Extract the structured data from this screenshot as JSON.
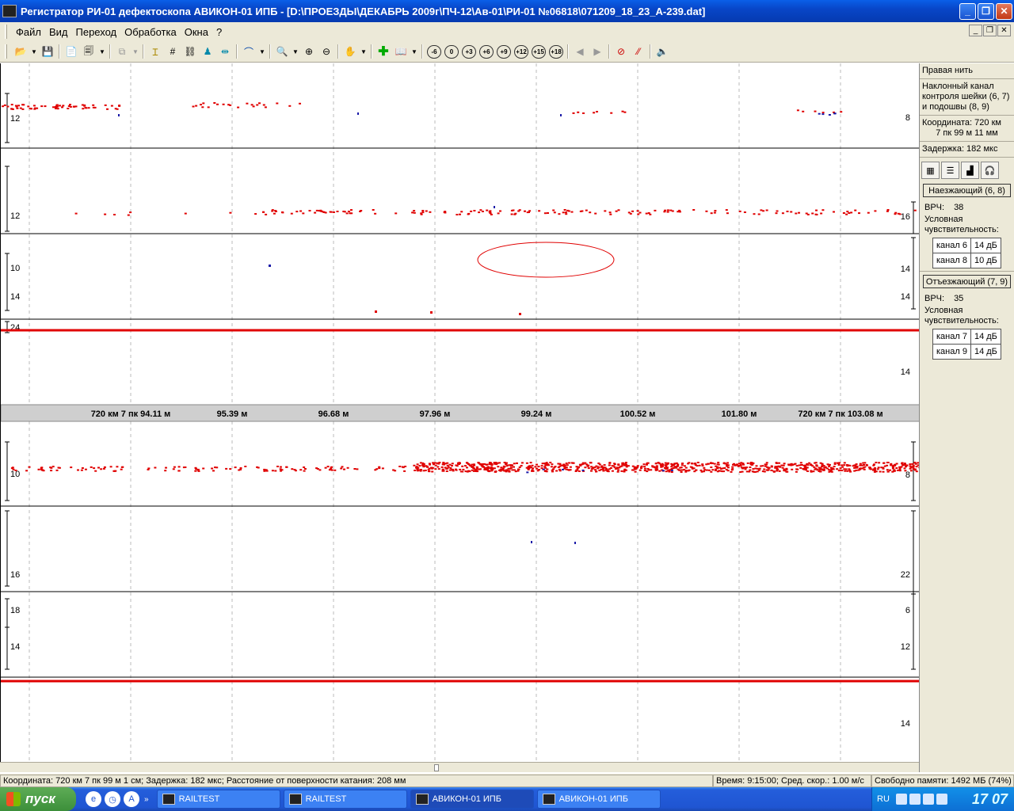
{
  "window": {
    "title": "Регистратор РИ-01 дефектоскопа АВИКОН-01 ИПБ - [D:\\ПРОЕЗДЫ\\ДЕКАБРЬ 2009г\\ПЧ-12\\Ав-01\\РИ-01 №06818\\071209_18_23_A-239.dat]",
    "min": "_",
    "max": "❐",
    "close": "✕"
  },
  "menu": [
    "Файл",
    "Вид",
    "Переход",
    "Обработка",
    "Окна",
    "?"
  ],
  "mdi": [
    "_",
    "❐",
    "✕"
  ],
  "toolbar": {
    "range_buttons": [
      "-6",
      "0",
      "+3",
      "+6",
      "+9",
      "+12",
      "+15",
      "+18"
    ]
  },
  "plot": {
    "divider_labels": [
      "720 км 7 пк 94.11 м",
      "95.39 м",
      "96.68 м",
      "97.96 м",
      "99.24 м",
      "100.52 м",
      "101.80 м",
      "720 км 7 пк 103.08 м"
    ],
    "left_labels": [
      "12",
      "12",
      "10",
      "14",
      "24",
      "10",
      "16",
      "18",
      "14"
    ],
    "right_labels": [
      "8",
      "16",
      "14",
      "14",
      "14",
      "8",
      "22",
      "6",
      "12",
      "14"
    ]
  },
  "right_panel": {
    "thread": "Правая нить",
    "channel_desc": "Наклонный канал контроля шейки (6, 7) и подошвы (8, 9)",
    "coord_line1": "Координата: 720 км",
    "coord_line2": "7 пк 99 м 11 мм",
    "delay": "Задержка: 182 мкс",
    "incoming": {
      "title": "Наезжающий (6, 8)",
      "vrch_label": "ВРЧ:",
      "vrch_value": "38",
      "sens_label": "Условная чувствительность:",
      "rows": [
        [
          "канал 6",
          "14 дБ"
        ],
        [
          "канал 8",
          "10 дБ"
        ]
      ]
    },
    "outgoing": {
      "title": "Отъезжающий (7, 9)",
      "vrch_label": "ВРЧ:",
      "vrch_value": "35",
      "sens_label": "Условная чувствительность:",
      "rows": [
        [
          "канал 7",
          "14 дБ"
        ],
        [
          "канал 9",
          "14 дБ"
        ]
      ]
    }
  },
  "status": {
    "left": "Координата: 720 км 7 пк 99 м 1 см; Задержка: 182 мкс; Расстояние от поверхности катания: 208 мм",
    "time": "Время: 9:15:00; Сред. скор.: 1.00 м/с",
    "memory": "Свободно памяти: 1492  МБ (74%)"
  },
  "taskbar": {
    "start": "пуск",
    "tasks": [
      "RAILTEST",
      "RAILTEST",
      "АВИКОН-01 ИПБ",
      "АВИКОН-01 ИПБ"
    ],
    "lang": "RU",
    "clock": "17 07"
  },
  "colors": {
    "signal": "#e00000",
    "blue": "#1a1aa8",
    "panel": "#ece9d8"
  }
}
